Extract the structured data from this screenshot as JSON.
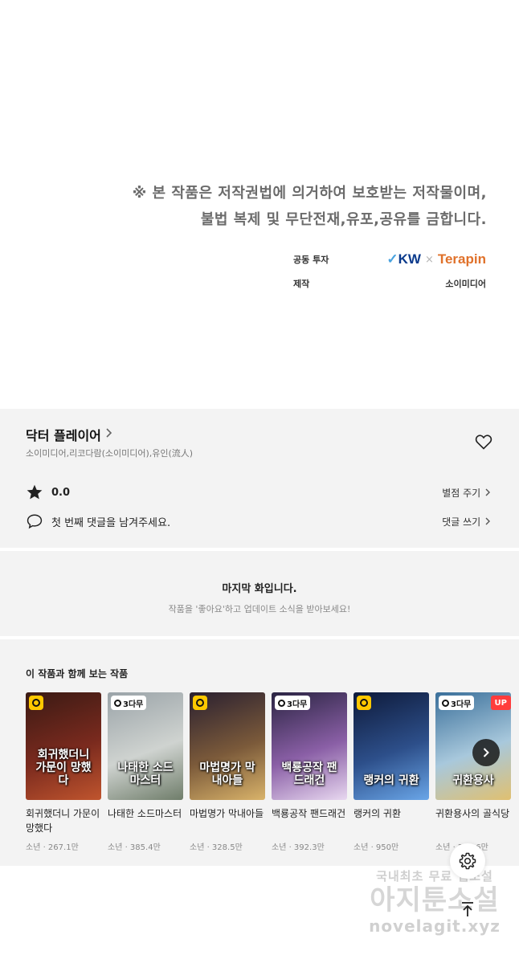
{
  "notice": {
    "copyright_line1": "※ 본 작품은 저작권법에 의거하여 보호받는 저작물이며,",
    "copyright_line2": "불법 복제 및 무단전재,유포,공유를 금합니다.",
    "coinvest_label": "공동 투자",
    "logo_kw": "KW",
    "logo_sep": "×",
    "logo_terapin": "Terapin",
    "production_label": "제작",
    "production_value": "소이미디어"
  },
  "work": {
    "title": "닥터 플레이어",
    "authors": "소이미디어,리코다람(소이미디어),유인(流人)",
    "rating": "0.0",
    "rate_action": "별점 주기",
    "comment_prompt": "첫 번째 댓글을 남겨주세요.",
    "comment_action": "댓글 쓰기"
  },
  "last_episode": {
    "title": "마지막 화입니다.",
    "subtitle": "작품을 '좋아요'하고 업데이트 소식을 받아보세요!"
  },
  "recommendations": {
    "heading": "이 작품과 함께 보는 작품",
    "items": [
      {
        "title": "회귀했더니 가문이 망했다",
        "meta": "소년 · 267.1만",
        "cover_text": "회귀했더니 가문이 망했다",
        "free_badge": "",
        "up_badge": "",
        "colors": [
          "#3a1a14",
          "#7a2a1e",
          "#c0552e"
        ]
      },
      {
        "title": "나태한 소드마스터",
        "meta": "소년 · 385.4만",
        "cover_text": "나태한 소드마스터",
        "free_badge": "3다무",
        "up_badge": "",
        "colors": [
          "#9aa3a8",
          "#cfd3d0",
          "#6f7d6a"
        ]
      },
      {
        "title": "마법명가 막내아들",
        "meta": "소년 · 328.5만",
        "cover_text": "마법명가 막내아들",
        "free_badge": "",
        "up_badge": "",
        "colors": [
          "#2a2030",
          "#7b5a3a",
          "#d9b36a"
        ]
      },
      {
        "title": "백룡공작 팬드래건",
        "meta": "소년 · 392.3만",
        "cover_text": "백룡공작 팬드래건",
        "free_badge": "3다무",
        "up_badge": "",
        "colors": [
          "#2a2442",
          "#8a5fa6",
          "#e8d8f0"
        ]
      },
      {
        "title": "랭커의 귀환",
        "meta": "소년 · 950만",
        "cover_text": "랭커의 귀환",
        "free_badge": "",
        "up_badge": "",
        "colors": [
          "#0e1a3a",
          "#2d4f8a",
          "#6aa6e8"
        ]
      },
      {
        "title": "귀환용사의 골식당",
        "meta": "소년 · 266.6만",
        "cover_text": "귀환용사",
        "free_badge": "3다무",
        "up_badge": "UP",
        "colors": [
          "#3a6f9a",
          "#a8c8dc",
          "#e0c070"
        ]
      }
    ]
  },
  "watermark": {
    "line1": "국내최초 무료 웹소설",
    "line2": "아지툰소설",
    "line3": "novelagit.xyz"
  },
  "colors": {
    "panel_bg": "#f3f3f3",
    "badge_yellow": "#ffc800",
    "badge_up": "#ff3c3c",
    "kw_blue": "#0a3a8c",
    "terapin_orange": "#e0712a"
  }
}
